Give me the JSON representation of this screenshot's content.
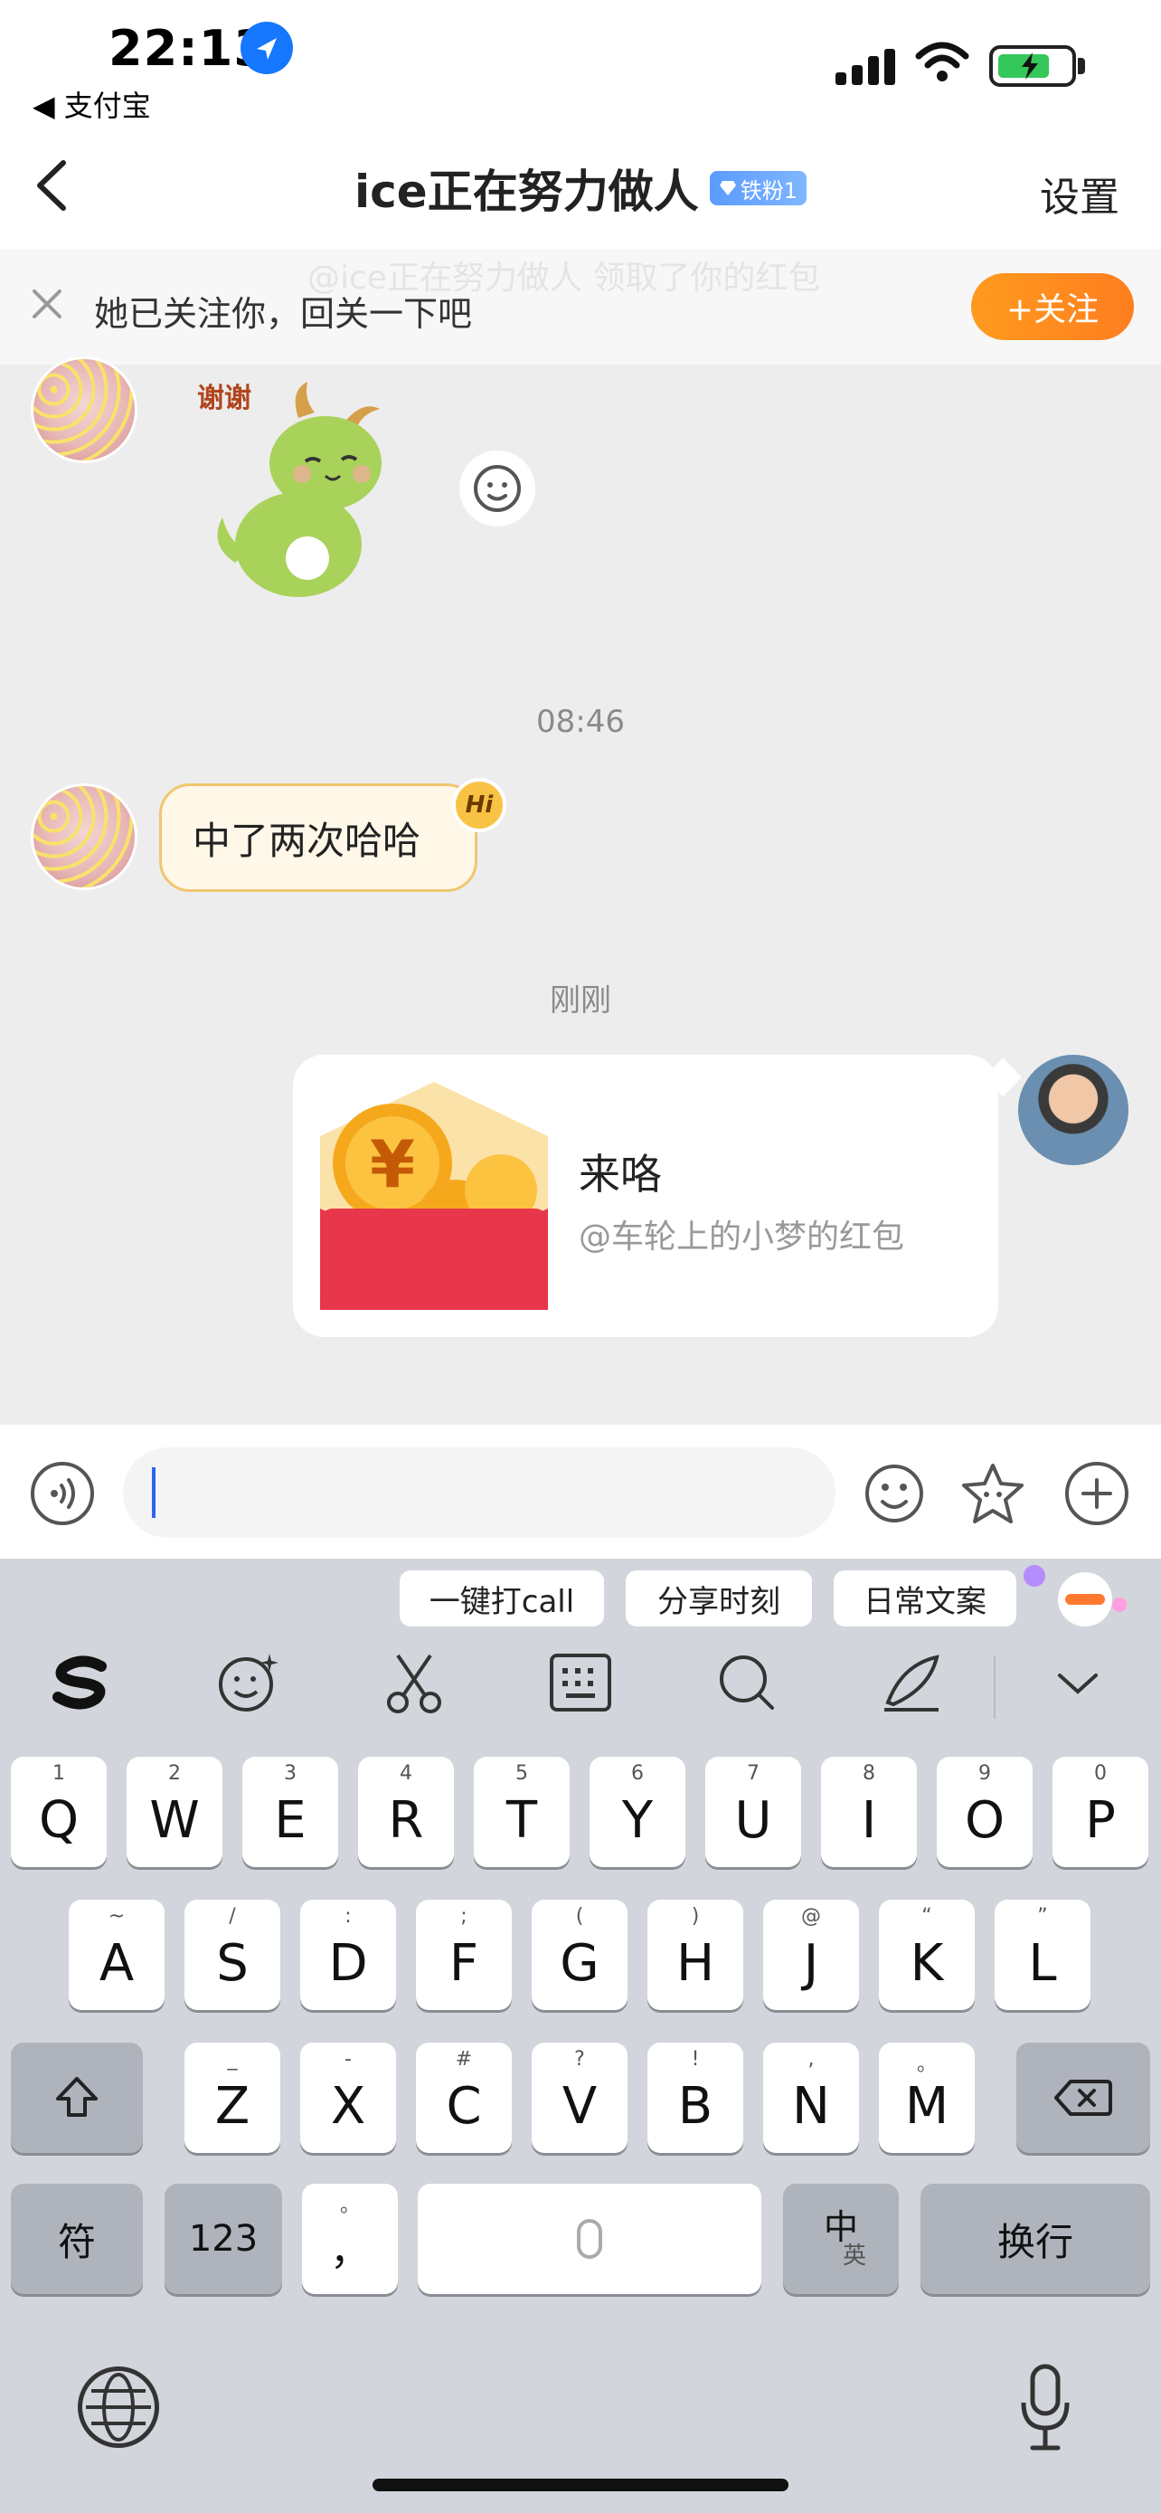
{
  "status_bar": {
    "time": "22:13",
    "back_app": "◀ 支付宝",
    "battery_color": "#34c759"
  },
  "nav": {
    "title": "ice正在努力做人",
    "fan_badge": "铁粉1",
    "settings": "设置"
  },
  "follow_bar": {
    "ghost_text": "@ice正在努力做人 领取了你的红包",
    "text": "她已关注你，回关一下吧",
    "button": "+关注"
  },
  "chat": {
    "sticker_caption": "谢谢",
    "time1": "08:46",
    "message1": "中了两次哈哈",
    "hi_badge": "Hi",
    "time2": "刚刚",
    "red_packet": {
      "title": "来咯",
      "subtitle": "@车轮上的小梦的红包"
    }
  },
  "input_bar": {
    "placeholder": ""
  },
  "keyboard": {
    "suggestions": [
      "一键打call",
      "分享时刻",
      "日常文案"
    ],
    "row1": [
      {
        "ch": "Q",
        "sub": "1"
      },
      {
        "ch": "W",
        "sub": "2"
      },
      {
        "ch": "E",
        "sub": "3"
      },
      {
        "ch": "R",
        "sub": "4"
      },
      {
        "ch": "T",
        "sub": "5"
      },
      {
        "ch": "Y",
        "sub": "6"
      },
      {
        "ch": "U",
        "sub": "7"
      },
      {
        "ch": "I",
        "sub": "8"
      },
      {
        "ch": "O",
        "sub": "9"
      },
      {
        "ch": "P",
        "sub": "0"
      }
    ],
    "row2": [
      {
        "ch": "A",
        "sub": "~"
      },
      {
        "ch": "S",
        "sub": "/"
      },
      {
        "ch": "D",
        "sub": ":"
      },
      {
        "ch": "F",
        "sub": ";"
      },
      {
        "ch": "G",
        "sub": "("
      },
      {
        "ch": "H",
        "sub": ")"
      },
      {
        "ch": "J",
        "sub": "@"
      },
      {
        "ch": "K",
        "sub": "“"
      },
      {
        "ch": "L",
        "sub": "”"
      }
    ],
    "row3": [
      {
        "ch": "Z",
        "sub": "_"
      },
      {
        "ch": "X",
        "sub": "-"
      },
      {
        "ch": "C",
        "sub": "#"
      },
      {
        "ch": "V",
        "sub": "?"
      },
      {
        "ch": "B",
        "sub": "!"
      },
      {
        "ch": "N",
        "sub": ","
      },
      {
        "ch": "M",
        "sub": "。"
      }
    ],
    "symbol_key": "符",
    "num_key": "123",
    "comma_key": "，",
    "comma_sub": "。",
    "lang_key": "中",
    "lang_sub": "英",
    "return_key": "换行"
  }
}
